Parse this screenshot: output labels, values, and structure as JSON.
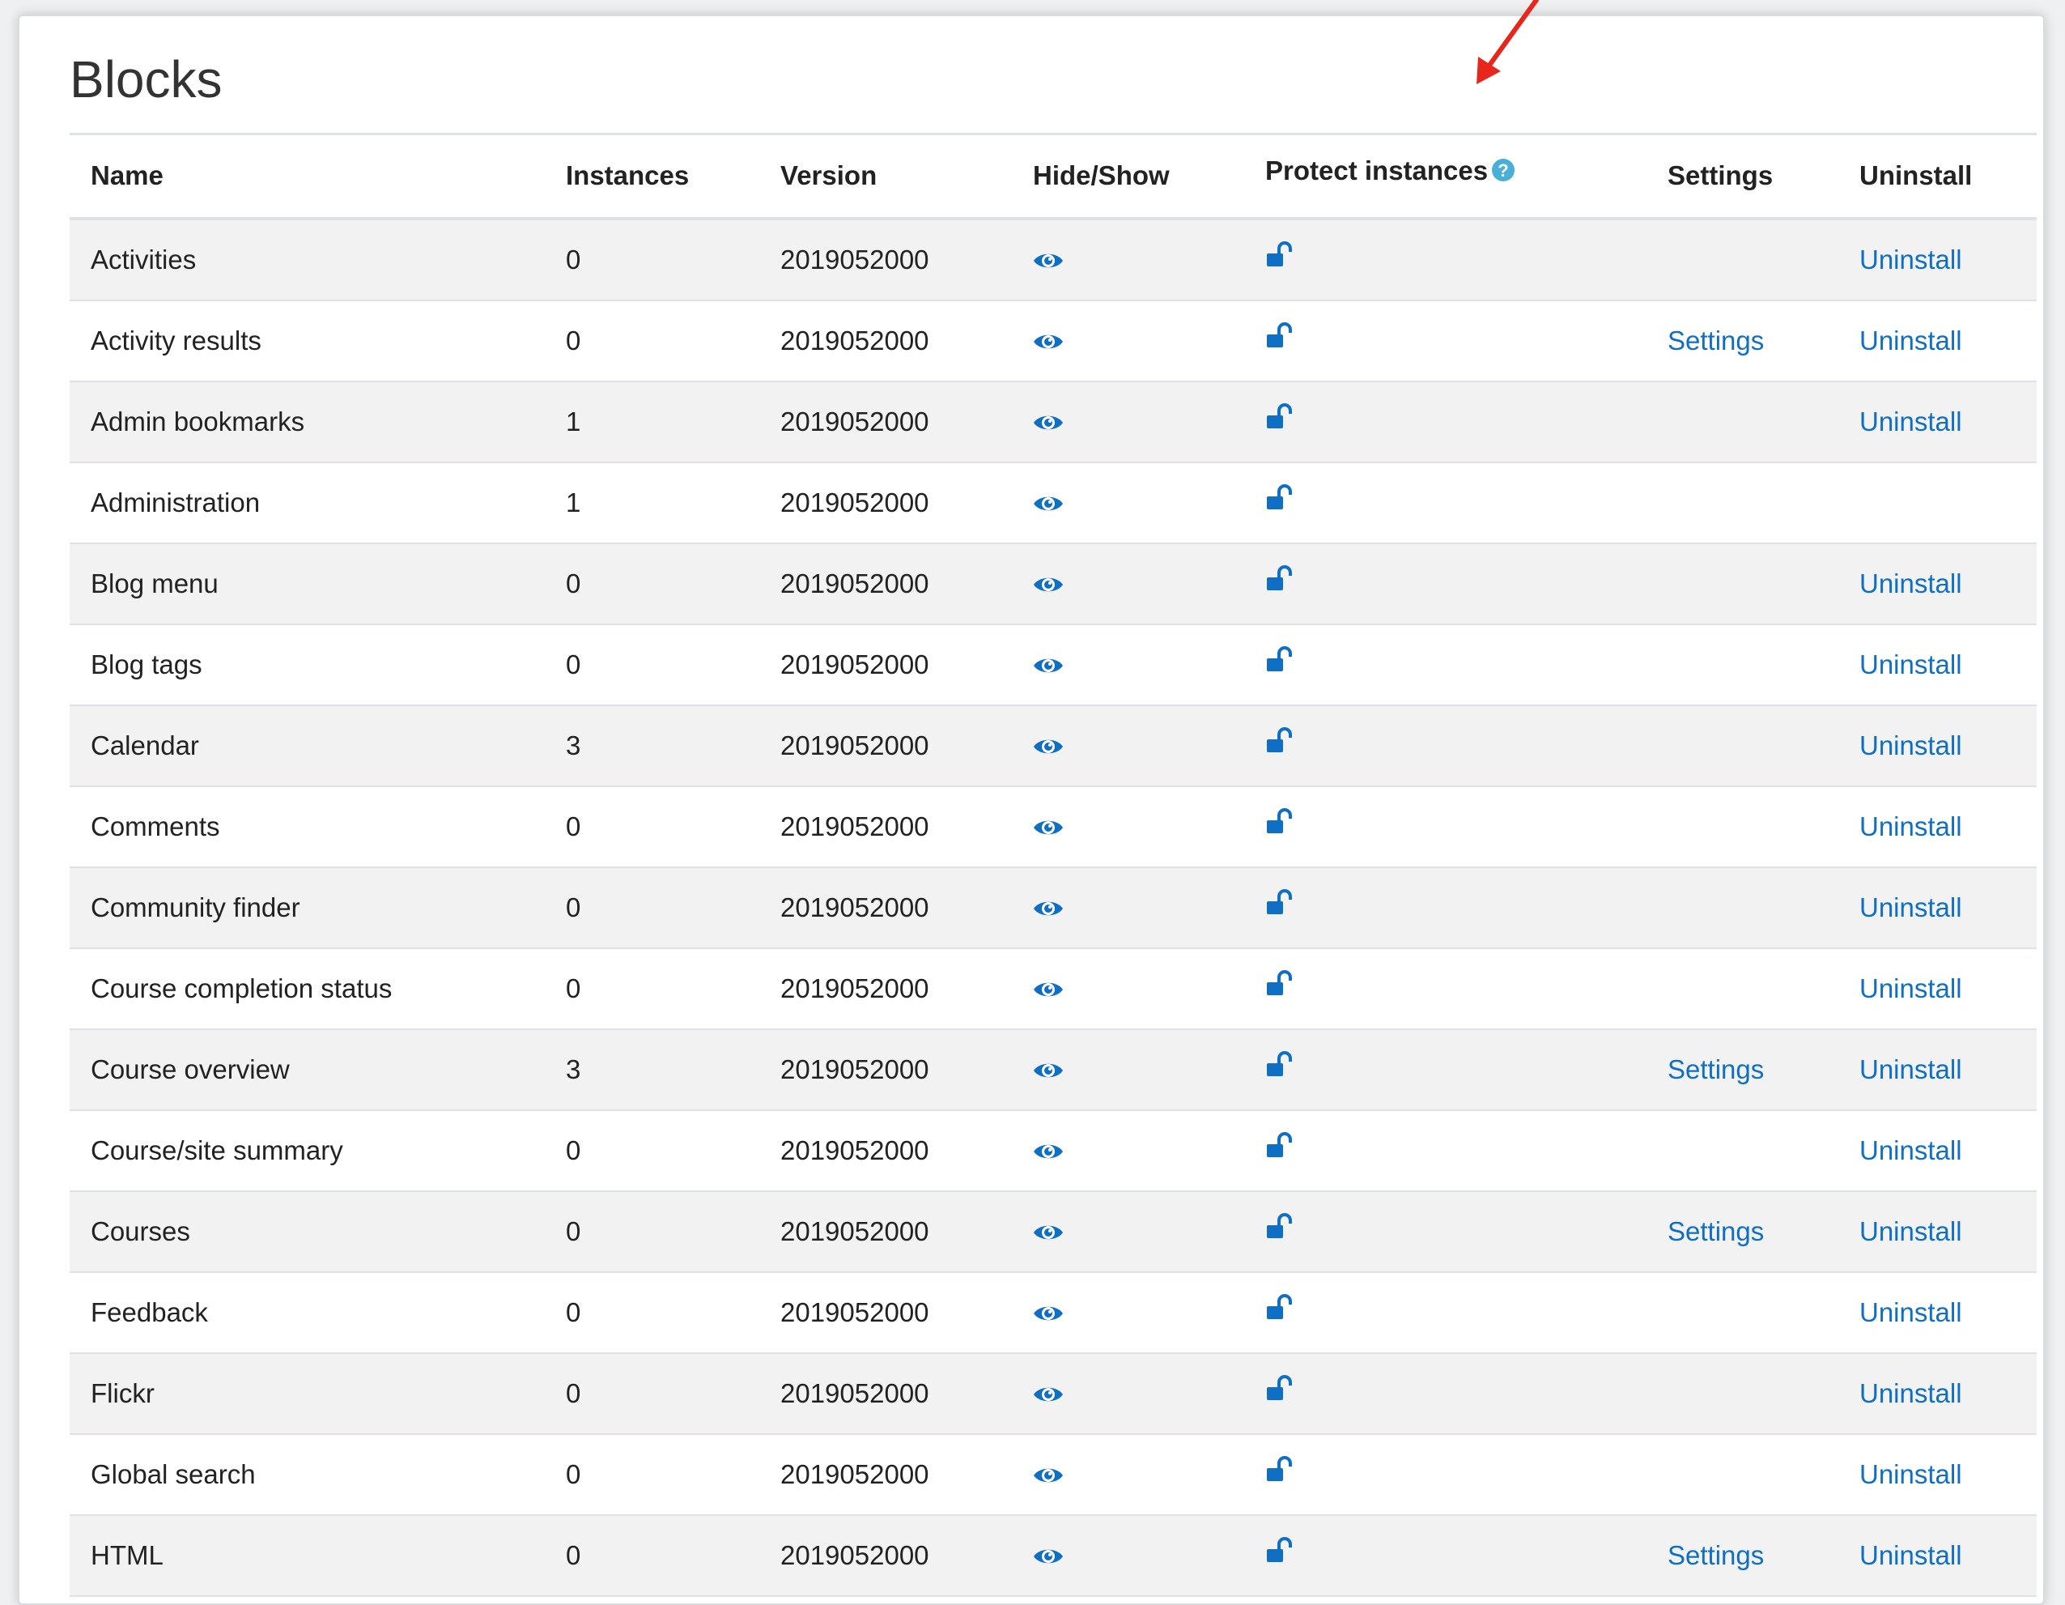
{
  "page": {
    "title": "Blocks"
  },
  "table": {
    "headers": {
      "name": "Name",
      "instances": "Instances",
      "version": "Version",
      "hide_show": "Hide/Show",
      "protect_instances": "Protect instances",
      "settings": "Settings",
      "uninstall": "Uninstall"
    },
    "rows": [
      {
        "name": "Activities",
        "instances": "0",
        "version": "2019052000",
        "settings": "",
        "uninstall": "Uninstall"
      },
      {
        "name": "Activity results",
        "instances": "0",
        "version": "2019052000",
        "settings": "Settings",
        "uninstall": "Uninstall"
      },
      {
        "name": "Admin bookmarks",
        "instances": "1",
        "version": "2019052000",
        "settings": "",
        "uninstall": "Uninstall"
      },
      {
        "name": "Administration",
        "instances": "1",
        "version": "2019052000",
        "settings": "",
        "uninstall": ""
      },
      {
        "name": "Blog menu",
        "instances": "0",
        "version": "2019052000",
        "settings": "",
        "uninstall": "Uninstall"
      },
      {
        "name": "Blog tags",
        "instances": "0",
        "version": "2019052000",
        "settings": "",
        "uninstall": "Uninstall"
      },
      {
        "name": "Calendar",
        "instances": "3",
        "version": "2019052000",
        "settings": "",
        "uninstall": "Uninstall"
      },
      {
        "name": "Comments",
        "instances": "0",
        "version": "2019052000",
        "settings": "",
        "uninstall": "Uninstall"
      },
      {
        "name": "Community finder",
        "instances": "0",
        "version": "2019052000",
        "settings": "",
        "uninstall": "Uninstall"
      },
      {
        "name": "Course completion status",
        "instances": "0",
        "version": "2019052000",
        "settings": "",
        "uninstall": "Uninstall"
      },
      {
        "name": "Course overview",
        "instances": "3",
        "version": "2019052000",
        "settings": "Settings",
        "uninstall": "Uninstall"
      },
      {
        "name": "Course/site summary",
        "instances": "0",
        "version": "2019052000",
        "settings": "",
        "uninstall": "Uninstall"
      },
      {
        "name": "Courses",
        "instances": "0",
        "version": "2019052000",
        "settings": "Settings",
        "uninstall": "Uninstall"
      },
      {
        "name": "Feedback",
        "instances": "0",
        "version": "2019052000",
        "settings": "",
        "uninstall": "Uninstall"
      },
      {
        "name": "Flickr",
        "instances": "0",
        "version": "2019052000",
        "settings": "",
        "uninstall": "Uninstall"
      },
      {
        "name": "Global search",
        "instances": "0",
        "version": "2019052000",
        "settings": "",
        "uninstall": "Uninstall"
      },
      {
        "name": "HTML",
        "instances": "0",
        "version": "2019052000",
        "settings": "Settings",
        "uninstall": "Uninstall"
      }
    ]
  },
  "icons": {
    "hide_show": "eye-icon",
    "protect": "unlock-icon",
    "help": "help-icon",
    "annotation": "red-arrow"
  },
  "colors": {
    "link": "#0f6fc5",
    "help": "#48b0d8",
    "annotation_arrow": "#e8261b",
    "stripe": "#f2f2f2"
  }
}
